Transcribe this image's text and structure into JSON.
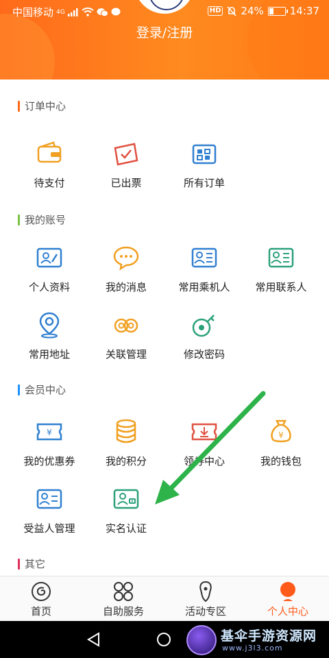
{
  "status_bar": {
    "carrier": "中国移动",
    "network": "4G",
    "hd": "HD",
    "battery": "24%",
    "time": "14:37"
  },
  "header": {
    "login_label": "登录/注册"
  },
  "sections": {
    "orders": {
      "title": "订单中心",
      "color": "#ff6a1a",
      "items": [
        {
          "label": "待支付",
          "icon": "wallet-icon"
        },
        {
          "label": "已出票",
          "icon": "ticket-issued-icon"
        },
        {
          "label": "所有订单",
          "icon": "all-orders-icon"
        }
      ]
    },
    "account": {
      "title": "我的账号",
      "color": "#7ac143",
      "items": [
        {
          "label": "个人资料",
          "icon": "profile-card-icon"
        },
        {
          "label": "我的消息",
          "icon": "message-icon"
        },
        {
          "label": "常用乘机人",
          "icon": "passenger-card-icon"
        },
        {
          "label": "常用联系人",
          "icon": "contact-card-icon"
        },
        {
          "label": "常用地址",
          "icon": "location-pin-icon"
        },
        {
          "label": "关联管理",
          "icon": "link-icon"
        },
        {
          "label": "修改密码",
          "icon": "key-icon"
        }
      ]
    },
    "member": {
      "title": "会员中心",
      "color": "#1e90ff",
      "items": [
        {
          "label": "我的优惠券",
          "icon": "coupon-icon"
        },
        {
          "label": "我的积分",
          "icon": "points-coins-icon"
        },
        {
          "label": "领券中心",
          "icon": "coupon-download-icon"
        },
        {
          "label": "我的钱包",
          "icon": "money-bag-icon"
        },
        {
          "label": "受益人管理",
          "icon": "beneficiary-card-icon"
        },
        {
          "label": "实名认证",
          "icon": "id-verify-icon"
        }
      ]
    },
    "other": {
      "title": "其它",
      "color": "#e0305a"
    }
  },
  "bottom_nav": {
    "tabs": [
      {
        "label": "首页",
        "icon": "home-icon"
      },
      {
        "label": "自助服务",
        "icon": "self-service-icon"
      },
      {
        "label": "活动专区",
        "icon": "activity-icon"
      },
      {
        "label": "个人中心",
        "icon": "profile-icon",
        "active": true
      }
    ]
  },
  "watermark": {
    "title": "基伞手游资源网",
    "url": "www.j3l3.com"
  },
  "colors": {
    "accent": "#ff6a1a",
    "icon_orange": "#f0a020",
    "icon_red": "#e05040",
    "icon_blue": "#2f7fd0",
    "icon_green": "#2aa07a",
    "arrow_green": "#2db34a"
  }
}
